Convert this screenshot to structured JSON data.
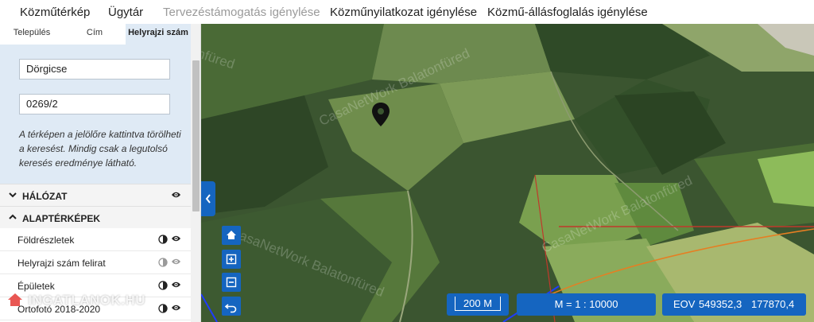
{
  "nav": {
    "items": [
      {
        "label": "Közműtérkép",
        "disabled": false
      },
      {
        "label": "Ügytár",
        "disabled": false
      },
      {
        "label": "Tervezéstámogatás igénylése",
        "disabled": true
      },
      {
        "label": "Közműnyilatkozat igénylése",
        "disabled": false
      },
      {
        "label": "Közmű-állásfoglalás igénylése",
        "disabled": false
      }
    ]
  },
  "search": {
    "tabs": [
      "Település",
      "Cím",
      "Helyrajzi szám"
    ],
    "active_tab": "Helyrajzi szám",
    "settlement_value": "Dörgicse",
    "parcel_value": "0269/2",
    "hint": "A térképen a jelölőre kattintva törölheti a keresést. Mindig csak a legutolsó keresés eredménye látható."
  },
  "sections": {
    "network": "HÁLÓZAT",
    "basemaps": "ALAPTÉRKÉPEK"
  },
  "layers": [
    {
      "label": "Földrészletek",
      "dim": false
    },
    {
      "label": "Helyrajzi szám felirat",
      "dim": true
    },
    {
      "label": "Épületek",
      "dim": false
    },
    {
      "label": "Ortofotó 2018-2020",
      "dim": false
    }
  ],
  "watermark": {
    "site": "INGATLANOK.HU",
    "map_text": "CasaNetWork Balatonfüred"
  },
  "map": {
    "scale_label": "200 M",
    "ratio_label": "M = 1 : 10000",
    "eov_label": "EOV",
    "eov_x": "549352,3",
    "eov_y": "177870,4"
  },
  "icons": {
    "eye": "eye-icon",
    "half_circle": "contrast-icon",
    "home": "home-icon",
    "zoom_in": "zoom-in-icon",
    "zoom_out": "zoom-out-icon",
    "back": "undo-icon",
    "marker": "map-marker-icon",
    "collapse": "chevron-left-icon"
  },
  "colors": {
    "accent": "#1565c0",
    "panel_bg": "#dfeaf5"
  }
}
